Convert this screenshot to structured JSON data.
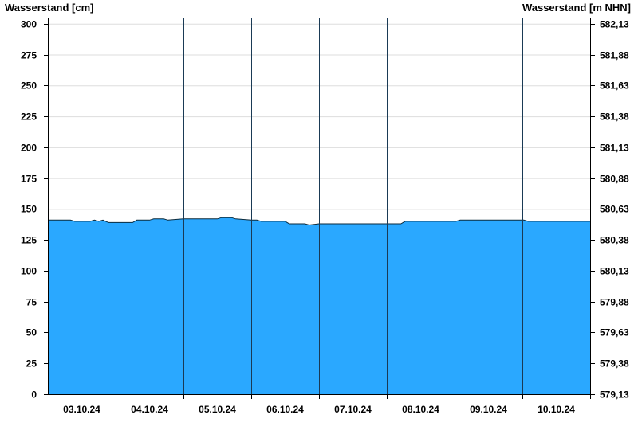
{
  "chart_data": {
    "type": "area",
    "ylabel": "Wasserstand [cm]",
    "y2label": "Wasserstand [m NHN]",
    "ylim": [
      0,
      305
    ],
    "y_ticks": [
      0,
      25,
      50,
      75,
      100,
      125,
      150,
      175,
      200,
      225,
      250,
      275,
      300
    ],
    "y_tick_labels": [
      "0",
      "25",
      "50",
      "75",
      "100",
      "125",
      "150",
      "175",
      "200",
      "225",
      "250",
      "275",
      "300"
    ],
    "y2_tick_labels": [
      "579,13",
      "579,38",
      "579,63",
      "579,88",
      "580,13",
      "580,38",
      "580,63",
      "580,88",
      "581,13",
      "581,38",
      "581,63",
      "581,88",
      "582,13"
    ],
    "x_range": [
      "2024-10-02T12:00",
      "2024-10-10T12:00"
    ],
    "x_tick_labels": [
      "03.10.24",
      "04.10.24",
      "05.10.24",
      "06.10.24",
      "07.10.24",
      "08.10.24",
      "09.10.24",
      "10.10.24"
    ],
    "day_separators": [
      "2024-10-03T12:00",
      "2024-10-04T12:00",
      "2024-10-05T12:00",
      "2024-10-06T12:00",
      "2024-10-07T12:00",
      "2024-10-08T12:00",
      "2024-10-09T12:00",
      "2024-10-10T12:00"
    ],
    "grid": true,
    "fill_color": "#2AA8FF",
    "series": [
      {
        "x": [
          "2024-10-02T12:00",
          "2024-10-02T20:00",
          "2024-10-02T21:30",
          "2024-10-03T03:00",
          "2024-10-03T04:30",
          "2024-10-03T06:00",
          "2024-10-03T07:30",
          "2024-10-03T08:30",
          "2024-10-03T09:30",
          "2024-10-03T12:00",
          "2024-10-03T14:00",
          "2024-10-03T18:00",
          "2024-10-03T19:30",
          "2024-10-04T00:00",
          "2024-10-04T01:30",
          "2024-10-04T05:00",
          "2024-10-04T06:30",
          "2024-10-04T12:00",
          "2024-10-04T19:00",
          "2024-10-05T00:00",
          "2024-10-05T01:30",
          "2024-10-05T05:00",
          "2024-10-05T06:30",
          "2024-10-05T12:00",
          "2024-10-05T14:00",
          "2024-10-05T15:30",
          "2024-10-06T00:00",
          "2024-10-06T01:30",
          "2024-10-06T07:00",
          "2024-10-06T08:30",
          "2024-10-06T12:00",
          "2024-10-07T12:00",
          "2024-10-07T17:00",
          "2024-10-07T18:30",
          "2024-10-08T12:00",
          "2024-10-08T12:30",
          "2024-10-08T14:00",
          "2024-10-09T12:00",
          "2024-10-09T12:30",
          "2024-10-09T14:00",
          "2024-10-10T12:00"
        ],
        "y": [
          141,
          141,
          140,
          140,
          141,
          140,
          141,
          140,
          139,
          139,
          139,
          139,
          141,
          141,
          142,
          142,
          141,
          142,
          142,
          142,
          143,
          143,
          142,
          141,
          141,
          140,
          140,
          138,
          138,
          137,
          138,
          138,
          138,
          140,
          140,
          140,
          141,
          141,
          141,
          140,
          140
        ]
      }
    ]
  }
}
